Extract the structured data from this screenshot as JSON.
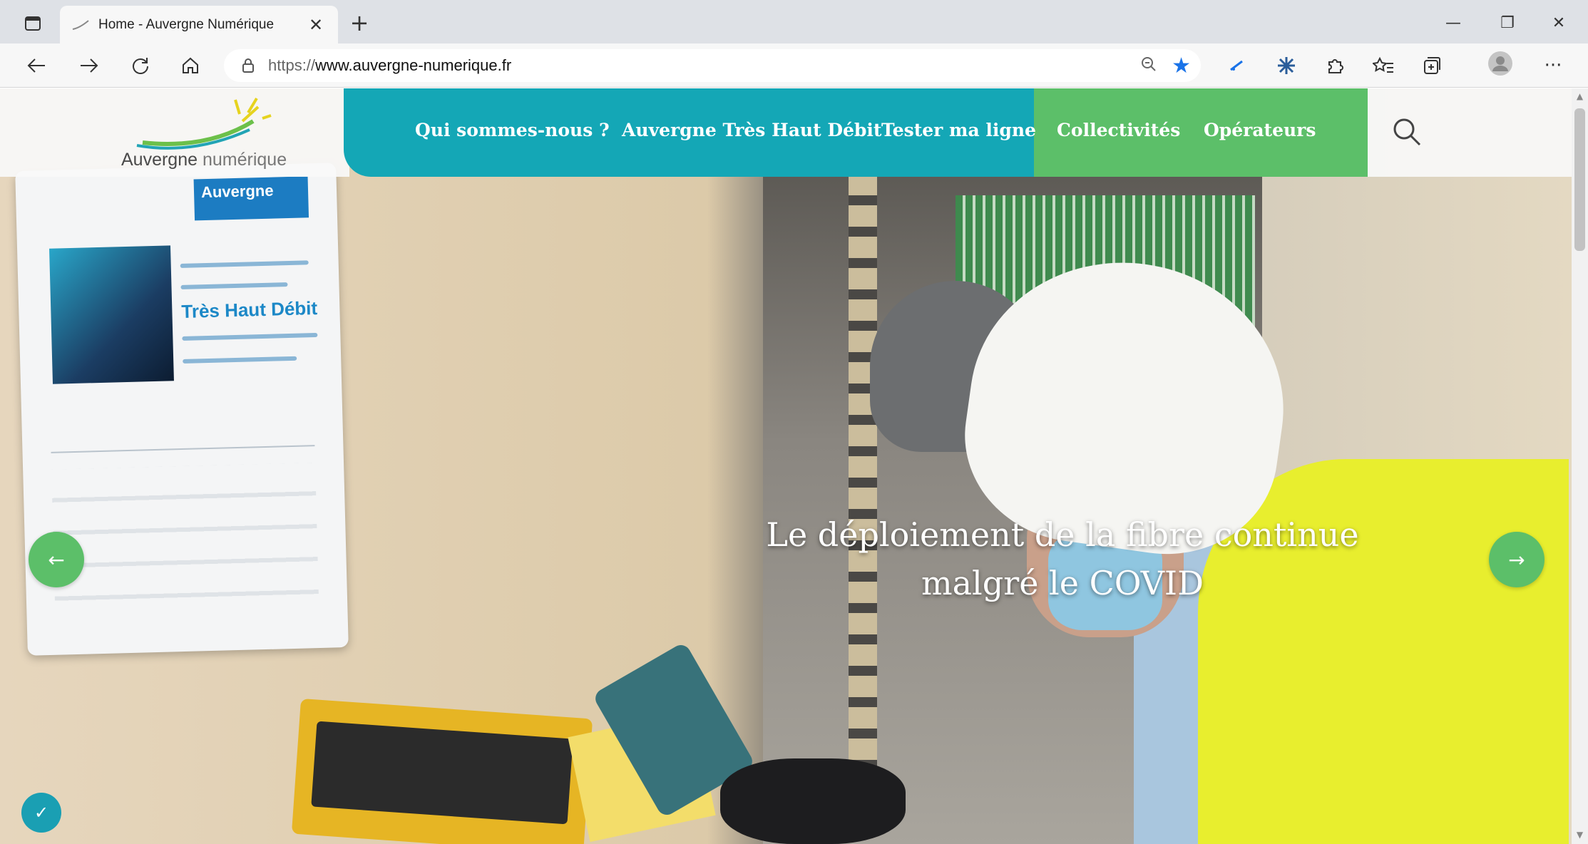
{
  "browser": {
    "tab_title": "Home - Auvergne Numérique",
    "tab_close": "✕",
    "new_tab": "+",
    "url_proto": "https://",
    "url_rest": "www.auvergne-numerique.fr",
    "window_controls": {
      "minimize": "—",
      "restore": "❐",
      "close": "✕"
    },
    "icons": [
      "back-icon",
      "forward-icon",
      "refresh-icon",
      "home-icon",
      "site-info-icon",
      "zoom-icon",
      "favorite-star-icon",
      "extension-icon",
      "puzzle-icon",
      "favorites-icon",
      "collections-icon",
      "profile-icon",
      "more-icon"
    ],
    "more": "···"
  },
  "site": {
    "logo": {
      "word1": "Auvergne",
      "word2": "numérique"
    },
    "nav": [
      {
        "label": "Qui sommes-nous ?"
      },
      {
        "label": "Auvergne Très Haut Débit"
      },
      {
        "label": "Tester ma ligne"
      },
      {
        "label": "Collectivités"
      },
      {
        "label": "Opérateurs"
      }
    ],
    "hero": {
      "caption_line1": "Le déploiement de la fibre continue",
      "caption_line2": "malgré le COVID",
      "prev_arrow": "←",
      "next_arrow": "→"
    },
    "sign": {
      "badge": "Auvergne",
      "headline": "Très Haut Débit"
    },
    "accessibility_icon": "✓"
  },
  "colors": {
    "nav_teal": "#14a7b6",
    "nav_green": "#5cbf69",
    "arrow_green": "#5cbf69",
    "star_blue": "#1a73e8"
  }
}
